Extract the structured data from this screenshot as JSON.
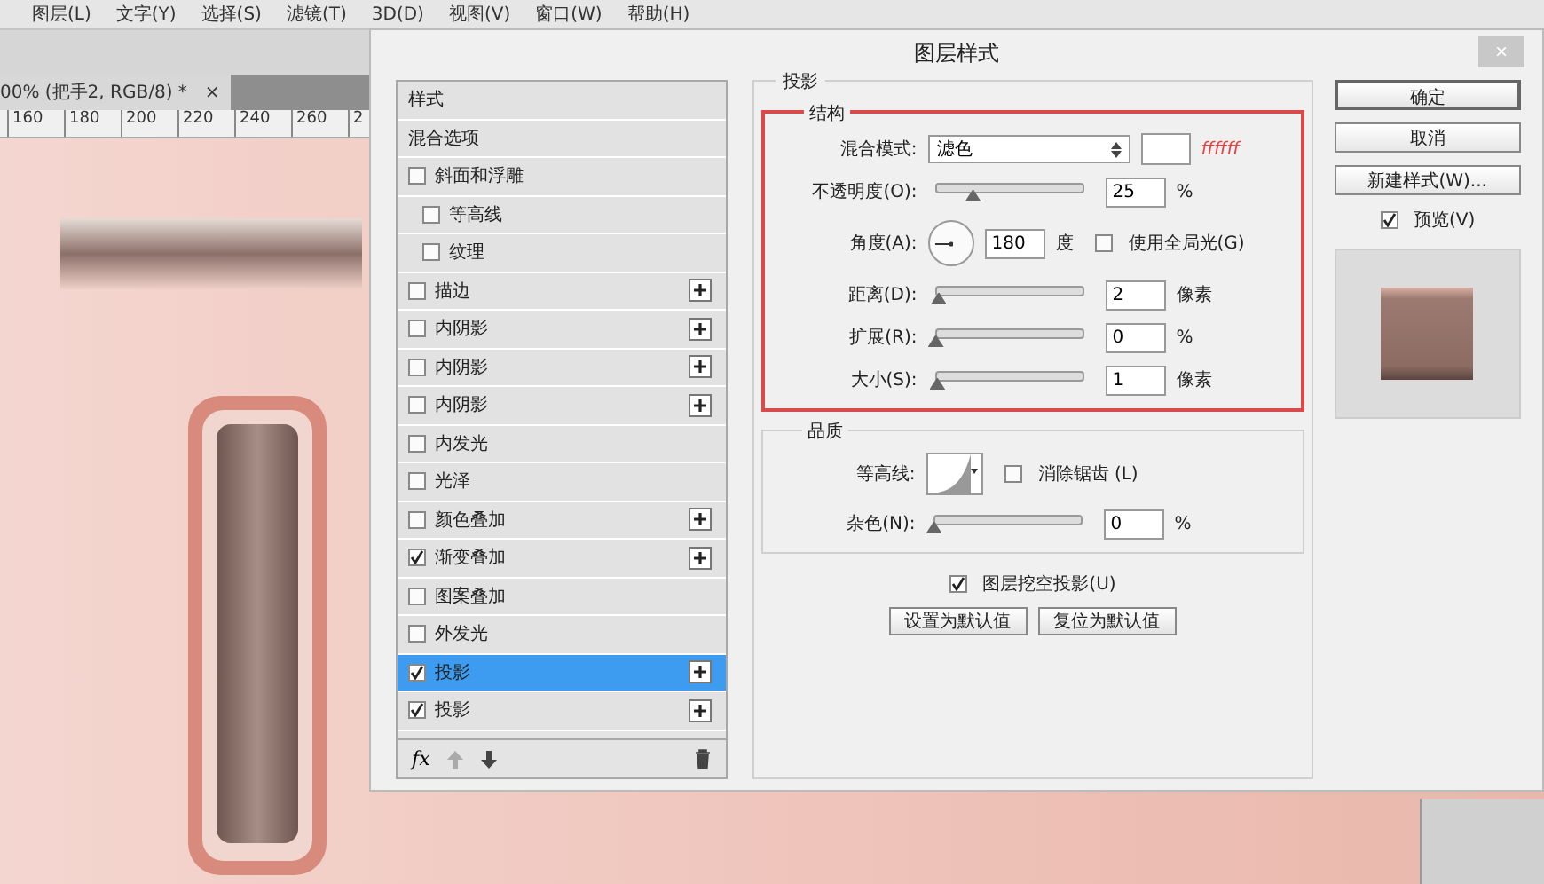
{
  "menu_bar": {
    "items": [
      "图层(L)",
      "文字(Y)",
      "选择(S)",
      "滤镜(T)",
      "3D(D)",
      "视图(V)",
      "窗口(W)",
      "帮助(H)"
    ]
  },
  "document_tab": {
    "title": "00% (把手2, RGB/8) *",
    "close": "×"
  },
  "ruler": {
    "ticks": [
      "160",
      "180",
      "200",
      "220",
      "240",
      "260",
      "2"
    ]
  },
  "dialog": {
    "title": "图层样式",
    "close": "×",
    "styles_list": [
      {
        "label": "样式",
        "kind": "header",
        "selected": false
      },
      {
        "label": "混合选项",
        "kind": "header",
        "selected": false
      },
      {
        "label": "斜面和浮雕",
        "kind": "option",
        "checked": false,
        "selected": false,
        "add_button": false,
        "children": [
          {
            "label": "等高线",
            "kind": "option",
            "checked": false,
            "selected": false,
            "add_button": false
          },
          {
            "label": "纹理",
            "kind": "option",
            "checked": false,
            "selected": false,
            "add_button": false
          }
        ]
      },
      {
        "label": "描边",
        "kind": "option",
        "checked": false,
        "selected": false,
        "add_button": true
      },
      {
        "label": "内阴影",
        "kind": "option",
        "checked": false,
        "selected": false,
        "add_button": true
      },
      {
        "label": "内阴影",
        "kind": "option",
        "checked": false,
        "selected": false,
        "add_button": true
      },
      {
        "label": "内阴影",
        "kind": "option",
        "checked": false,
        "selected": false,
        "add_button": true
      },
      {
        "label": "内发光",
        "kind": "option",
        "checked": false,
        "selected": false,
        "add_button": false
      },
      {
        "label": "光泽",
        "kind": "option",
        "checked": false,
        "selected": false,
        "add_button": false
      },
      {
        "label": "颜色叠加",
        "kind": "option",
        "checked": false,
        "selected": false,
        "add_button": true
      },
      {
        "label": "渐变叠加",
        "kind": "option",
        "checked": true,
        "selected": false,
        "add_button": true
      },
      {
        "label": "图案叠加",
        "kind": "option",
        "checked": false,
        "selected": false,
        "add_button": false
      },
      {
        "label": "外发光",
        "kind": "option",
        "checked": false,
        "selected": false,
        "add_button": false
      },
      {
        "label": "投影",
        "kind": "option",
        "checked": true,
        "selected": true,
        "add_button": true
      },
      {
        "label": "投影",
        "kind": "option",
        "checked": true,
        "selected": false,
        "add_button": true
      }
    ],
    "list_footer": {
      "fx": "fx"
    },
    "drop_shadow": {
      "title": "投影",
      "structure": {
        "title": "结构",
        "highlighted": true,
        "blend_mode": {
          "label": "混合模式:",
          "value": "滤色",
          "note": "ffffff"
        },
        "opacity": {
          "label": "不透明度(O):",
          "level": 0.25,
          "value": "25",
          "unit": "%"
        },
        "angle": {
          "label": "角度(A):",
          "value": "180",
          "unit": "度",
          "global_light": {
            "label": "使用全局光(G)",
            "checked": false
          }
        },
        "sliders": [
          {
            "label": "距离(D):",
            "level": 0.02,
            "value": "2",
            "unit": "像素"
          },
          {
            "label": "扩展(R):",
            "level": 0,
            "value": "0",
            "unit": "%"
          },
          {
            "label": "大小(S):",
            "level": 0.01,
            "value": "1",
            "unit": "像素"
          }
        ]
      },
      "quality": {
        "title": "品质",
        "contour_label": "等高线:",
        "anti_alias": {
          "label": "消除锯齿 (L)",
          "checked": false
        },
        "noise": {
          "label": "杂色(N):",
          "level": 0,
          "value": "0",
          "unit": "%"
        }
      },
      "knockout": {
        "label": "图层挖空投影(U)",
        "checked": true
      },
      "buttons": [
        "设置为默认值",
        "复位为默认值"
      ]
    },
    "side_buttons": [
      "确定",
      "取消",
      "新建样式(W)..."
    ],
    "preview": {
      "label": "预览(V)",
      "checked": true
    }
  }
}
